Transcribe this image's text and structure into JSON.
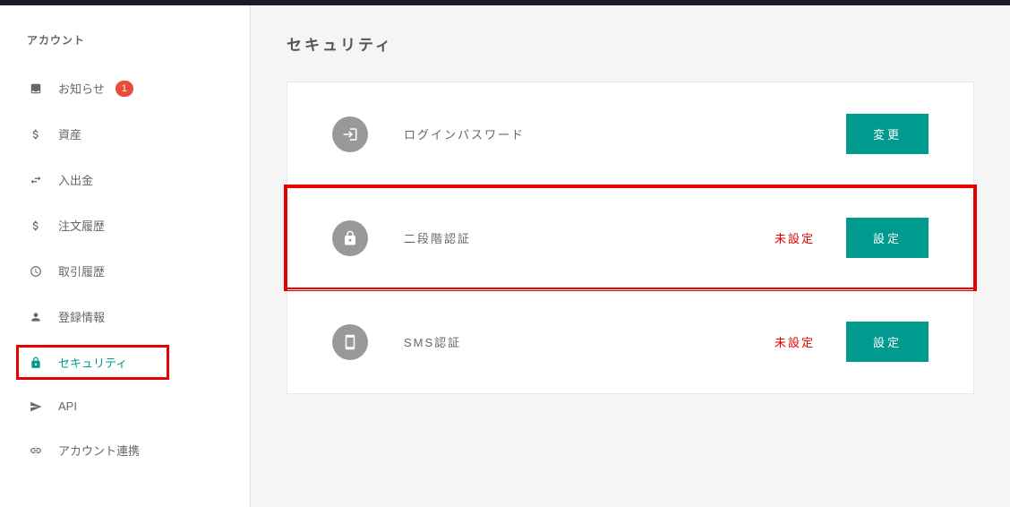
{
  "sidebar": {
    "header": "アカウント",
    "items": [
      {
        "label": "お知らせ",
        "badge": "1"
      },
      {
        "label": "資産"
      },
      {
        "label": "入出金"
      },
      {
        "label": "注文履歴"
      },
      {
        "label": "取引履歴"
      },
      {
        "label": "登録情報"
      },
      {
        "label": "セキュリティ"
      },
      {
        "label": "API"
      },
      {
        "label": "アカウント連携"
      }
    ]
  },
  "main": {
    "title": "セキュリティ",
    "settings": [
      {
        "label": "ログインパスワード",
        "status": "",
        "button": "変更"
      },
      {
        "label": "二段階認証",
        "status": "未設定",
        "button": "設定"
      },
      {
        "label": "SMS認証",
        "status": "未設定",
        "button": "設定"
      }
    ]
  }
}
